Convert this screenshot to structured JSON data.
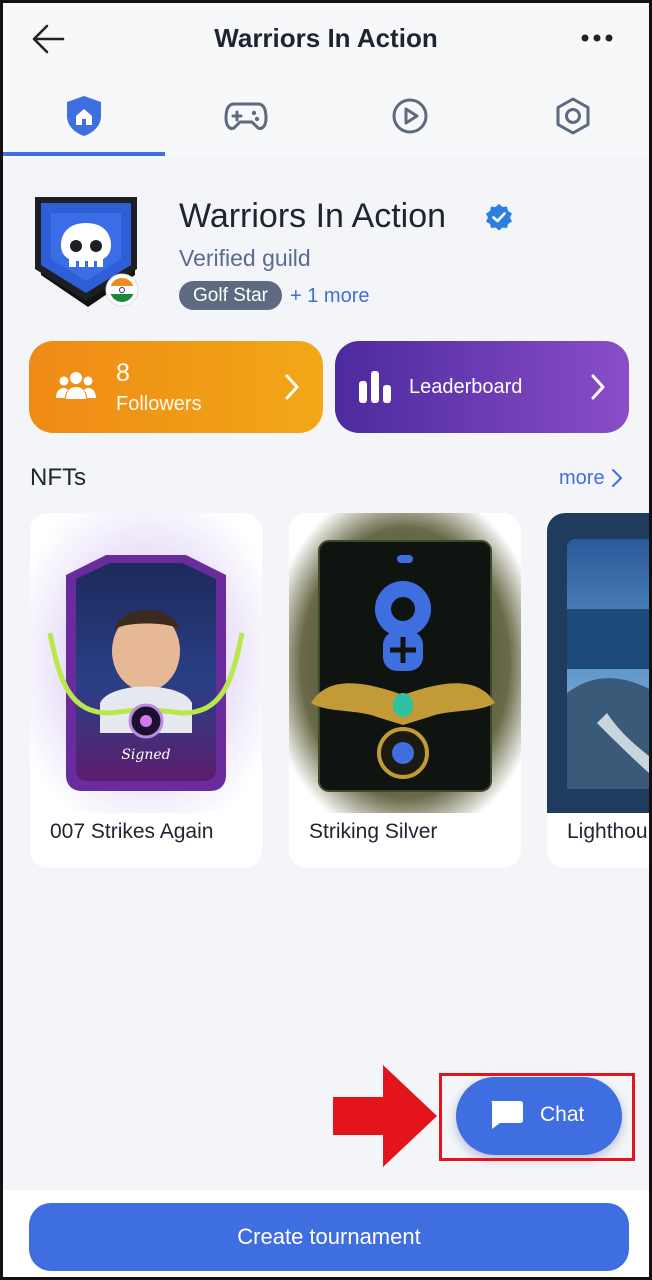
{
  "header": {
    "title": "Warriors In Action",
    "back_icon": "arrow-left-icon",
    "more_icon": "more-horizontal-icon"
  },
  "tabs": [
    {
      "icon": "shield-home-icon",
      "active": true
    },
    {
      "icon": "gamepad-icon",
      "active": false
    },
    {
      "icon": "play-circle-icon",
      "active": false
    },
    {
      "icon": "settings-hex-icon",
      "active": false
    }
  ],
  "guild": {
    "name": "Warriors In Action",
    "subtitle": "Verified guild",
    "tag": "Golf Star",
    "tag_more": "+ 1 more",
    "logo_icon": "skull-shield-icon",
    "flag_icon": "india-flag-icon",
    "verified_icon": "verified-badge-icon"
  },
  "stats": {
    "followers_count": "8",
    "followers_label": "Followers",
    "leaderboard_label": "Leaderboard"
  },
  "nfts": {
    "title": "NFTs",
    "more_label": "more",
    "items": [
      {
        "name": "007 Strikes Again",
        "caption": "Signed"
      },
      {
        "name": "Striking Silver"
      },
      {
        "name": "Lighthou"
      }
    ]
  },
  "chat": {
    "label": "Chat",
    "icon": "chat-bubble-icon"
  },
  "footer": {
    "create_label": "Create tournament"
  },
  "colors": {
    "accent": "#3f6ee0",
    "followers_gradient": [
      "#ef8a16",
      "#f2a817"
    ],
    "leaderboard_gradient": [
      "#4c2a9e",
      "#8a4dc7"
    ],
    "highlight": "#e3141c"
  }
}
